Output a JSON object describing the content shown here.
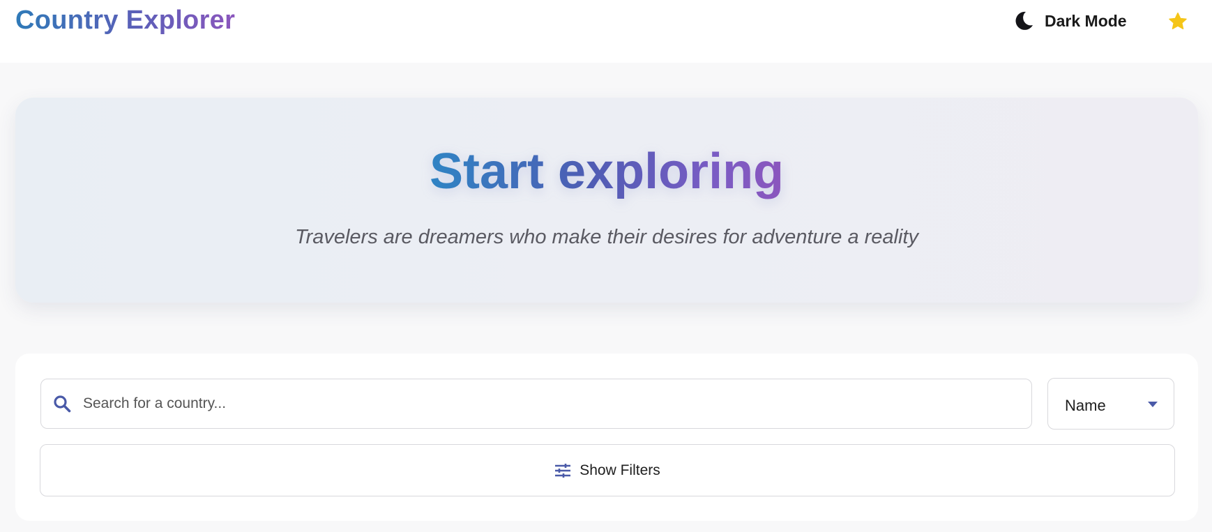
{
  "header": {
    "brand": "Country Explorer",
    "dark_mode_label": "Dark Mode",
    "dark_mode_icon": "moon-icon",
    "favorites_icon": "star-icon"
  },
  "hero": {
    "title": "Start exploring",
    "subtitle": "Travelers are dreamers who make their desires for adventure a reality"
  },
  "search": {
    "placeholder": "Search for a country...",
    "value": "",
    "icon": "search-icon"
  },
  "sort": {
    "selected": "Name",
    "icon": "chevron-down-icon"
  },
  "filters": {
    "label": "Show Filters",
    "icon": "sliders-icon"
  },
  "colors": {
    "accent": "#4e5cb3",
    "accent_gradient_start": "#2f7ab8",
    "accent_gradient_end": "#8b56bd",
    "star": "#f5c518"
  }
}
